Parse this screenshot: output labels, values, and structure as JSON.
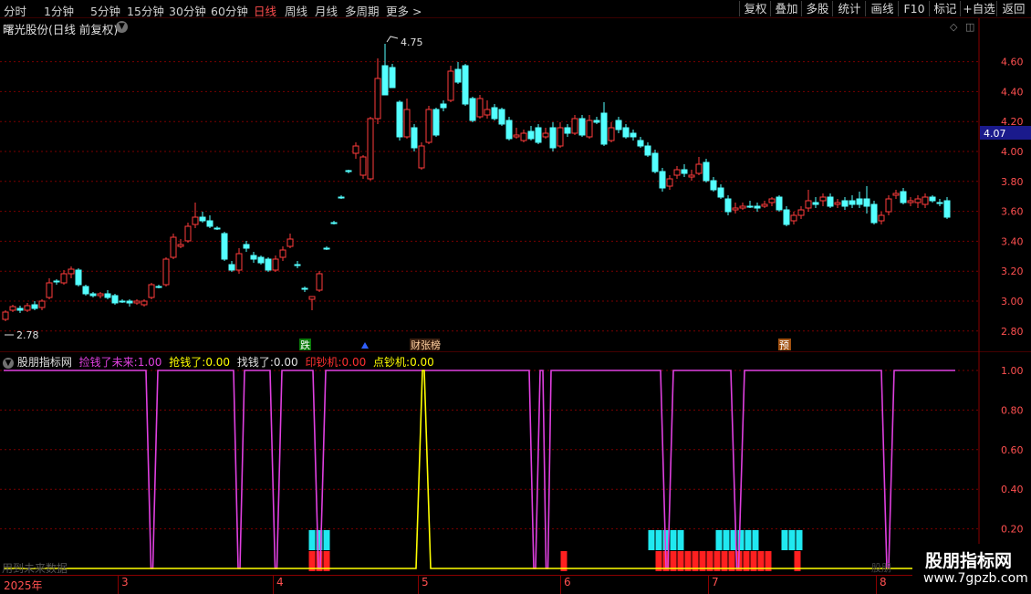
{
  "toolbar": {
    "periods": [
      "分时",
      "1分钟",
      "5分钟",
      "15分钟",
      "30分钟",
      "60分钟",
      "日线",
      "周线",
      "月线",
      "多周期",
      "更多 >"
    ],
    "active_period": "日线",
    "tools": [
      "复权",
      "叠加",
      "多股",
      "统计",
      "画线",
      "F10",
      "标记",
      "+自选",
      "返回"
    ]
  },
  "main_chart": {
    "title": "曙光股份(日线 前复权)",
    "price_axis": [
      "4.60",
      "4.40",
      "4.20",
      "4.00",
      "3.80",
      "3.60",
      "3.40",
      "3.20",
      "3.00",
      "2.80"
    ],
    "current_price": "4.07",
    "high_label": "4.75",
    "low_label": "2.78",
    "markers": {
      "drop": "跌",
      "limit_list": "财张榜",
      "forecast": "预"
    }
  },
  "indicator": {
    "name": "股朋指标网",
    "values": [
      {
        "label": "捡钱了未来:",
        "value": "1.00",
        "color": "#e040e0"
      },
      {
        "label": "抢钱了:",
        "value": "0.00",
        "color": "#ffff00"
      },
      {
        "label": "找钱了:",
        "value": "0.00",
        "color": "#e0e0e0"
      },
      {
        "label": "印钞机:",
        "value": "0.00",
        "color": "#ff3030"
      },
      {
        "label": "点钞机:",
        "value": "0.00",
        "color": "#ffff00"
      }
    ],
    "axis": [
      "1.00",
      "0.80",
      "0.60",
      "0.40",
      "0.20"
    ],
    "footer_note": "用到未来数据"
  },
  "time_axis": {
    "year": "2025年",
    "months": [
      "3",
      "4",
      "5",
      "6",
      "7",
      "8"
    ]
  },
  "watermark": {
    "name": "股朋指标网",
    "url": "www.7gpzb.com",
    "faint": "股朋"
  },
  "colors": {
    "up": "#ff3c3c",
    "down": "#54ffff",
    "indicator_line": "#e040e0",
    "alt_line": "#ffff00",
    "grid": "#7a0000"
  }
}
